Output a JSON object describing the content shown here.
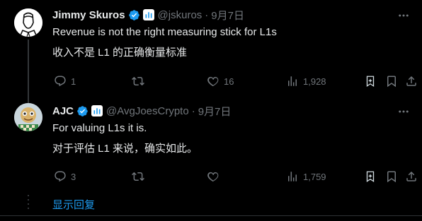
{
  "tweets": [
    {
      "name": "Jimmy Skuros",
      "handle": "@jskuros",
      "separator": "·",
      "date": "9月7日",
      "lines": [
        "Revenue is not the right measuring stick for L1s",
        "收入不是 L1 的正确衡量标准"
      ],
      "stats": {
        "replies": "1",
        "retweets": "",
        "likes": "16",
        "views": "1,928"
      }
    },
    {
      "name": "AJC",
      "handle": "@AvgJoesCrypto",
      "separator": "·",
      "date": "9月7日",
      "lines": [
        "For valuing L1s it is.",
        "对于评估 L1 来说，确实如此。"
      ],
      "stats": {
        "replies": "3",
        "retweets": "",
        "likes": "",
        "views": "1,759"
      }
    }
  ],
  "show_replies": "显示回复",
  "colors": {
    "background": "#000000",
    "text": "#e7e9ea",
    "muted": "#71767b",
    "accent": "#1d9bf0"
  }
}
